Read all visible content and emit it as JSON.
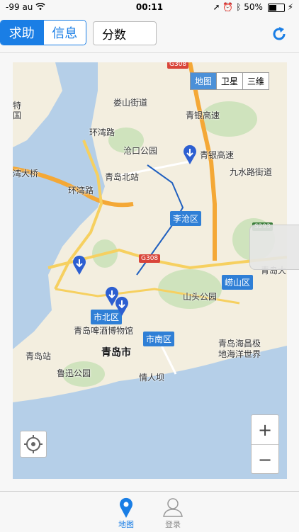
{
  "status_bar": {
    "signal": "-99",
    "carrier": "au",
    "time": "00:11",
    "battery_percent": "50%",
    "battery_level": 0.5
  },
  "nav": {
    "seg_help": "求助",
    "seg_info": "信息",
    "score_label": "分数"
  },
  "map": {
    "types": [
      "地图",
      "卫星",
      "三维"
    ],
    "labels": {
      "loushan": "娄山街道",
      "cangkou": "沧口公园",
      "qingdao_north": "青岛北站",
      "jiushui": "九水路街道",
      "qingdao_da": "青岛大",
      "shantou": "山头公园",
      "beer_museum": "青岛啤酒博物馆",
      "qingdao_station": "青岛站",
      "qingdao_city": "青岛市",
      "luxun": "鲁迅公园",
      "qingren": "情人坝",
      "haichang": "青岛海昌极",
      "haiyang": "地海洋世界",
      "bridge": "湾大桥",
      "huanwan": "环湾路",
      "huanwan2": "环湾路",
      "expressway": "青银高速",
      "bank": "青银高速",
      "te": "特",
      "guo": "国"
    },
    "districts": {
      "licang": "李沧区",
      "laoshan": "崂山区",
      "shibei": "市北区",
      "shinan": "市南区"
    },
    "road_tags": {
      "g308_top": "G308",
      "g308_mid": "G308",
      "s293": "S293"
    },
    "zoom_in": "+",
    "zoom_out": "−"
  },
  "tabs": {
    "map": "地图",
    "login": "登录"
  },
  "colors": {
    "accent": "#1a7ee5",
    "water": "#b5cfe8",
    "land": "#f3eedf",
    "road_major": "#f4a836",
    "district": "#2f7fd6"
  },
  "icons": [
    "wifi-icon",
    "location-arrow-icon",
    "alarm-icon",
    "bluetooth-icon",
    "charging-icon",
    "refresh-icon",
    "marker-icon",
    "locate-icon",
    "map-pin-icon",
    "user-icon"
  ]
}
